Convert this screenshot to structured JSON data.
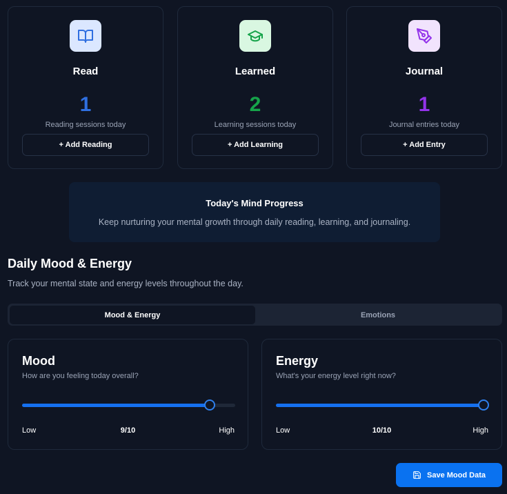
{
  "cards": [
    {
      "title": "Read",
      "count": "1",
      "subtitle": "Reading sessions today",
      "button_label": "+ Add Reading",
      "icon": "book-open-icon",
      "accent": "#2f6fe0",
      "icon_bg": "#dbe7ff"
    },
    {
      "title": "Learned",
      "count": "2",
      "subtitle": "Learning sessions today",
      "button_label": "+ Add Learning",
      "icon": "graduation-cap-icon",
      "accent": "#16a34a",
      "icon_bg": "#d9f7e1"
    },
    {
      "title": "Journal",
      "count": "1",
      "subtitle": "Journal entries today",
      "button_label": "+ Add Entry",
      "icon": "pen-tool-icon",
      "accent": "#9333ea",
      "icon_bg": "#f1e3fd"
    }
  ],
  "progress": {
    "title": "Today's Mind Progress",
    "text": "Keep nurturing your mental growth through daily reading, learning, and journaling."
  },
  "mood_section": {
    "title": "Daily Mood & Energy",
    "subtitle": "Track your mental state and energy levels throughout the day.",
    "tabs": [
      {
        "label": "Mood & Energy",
        "active": true
      },
      {
        "label": "Emotions",
        "active": false
      }
    ],
    "sliders": [
      {
        "title": "Mood",
        "description": "How are you feeling today overall?",
        "value": 9,
        "max": 10,
        "value_label": "9/10",
        "low_label": "Low",
        "high_label": "High"
      },
      {
        "title": "Energy",
        "description": "What's your energy level right now?",
        "value": 10,
        "max": 10,
        "value_label": "10/10",
        "low_label": "Low",
        "high_label": "High"
      }
    ],
    "save_label": "Save Mood Data",
    "save_icon": "save-icon"
  },
  "colors": {
    "background": "#0f1523",
    "primary": "#0a72f0",
    "slider_fill": "#1570ef"
  }
}
